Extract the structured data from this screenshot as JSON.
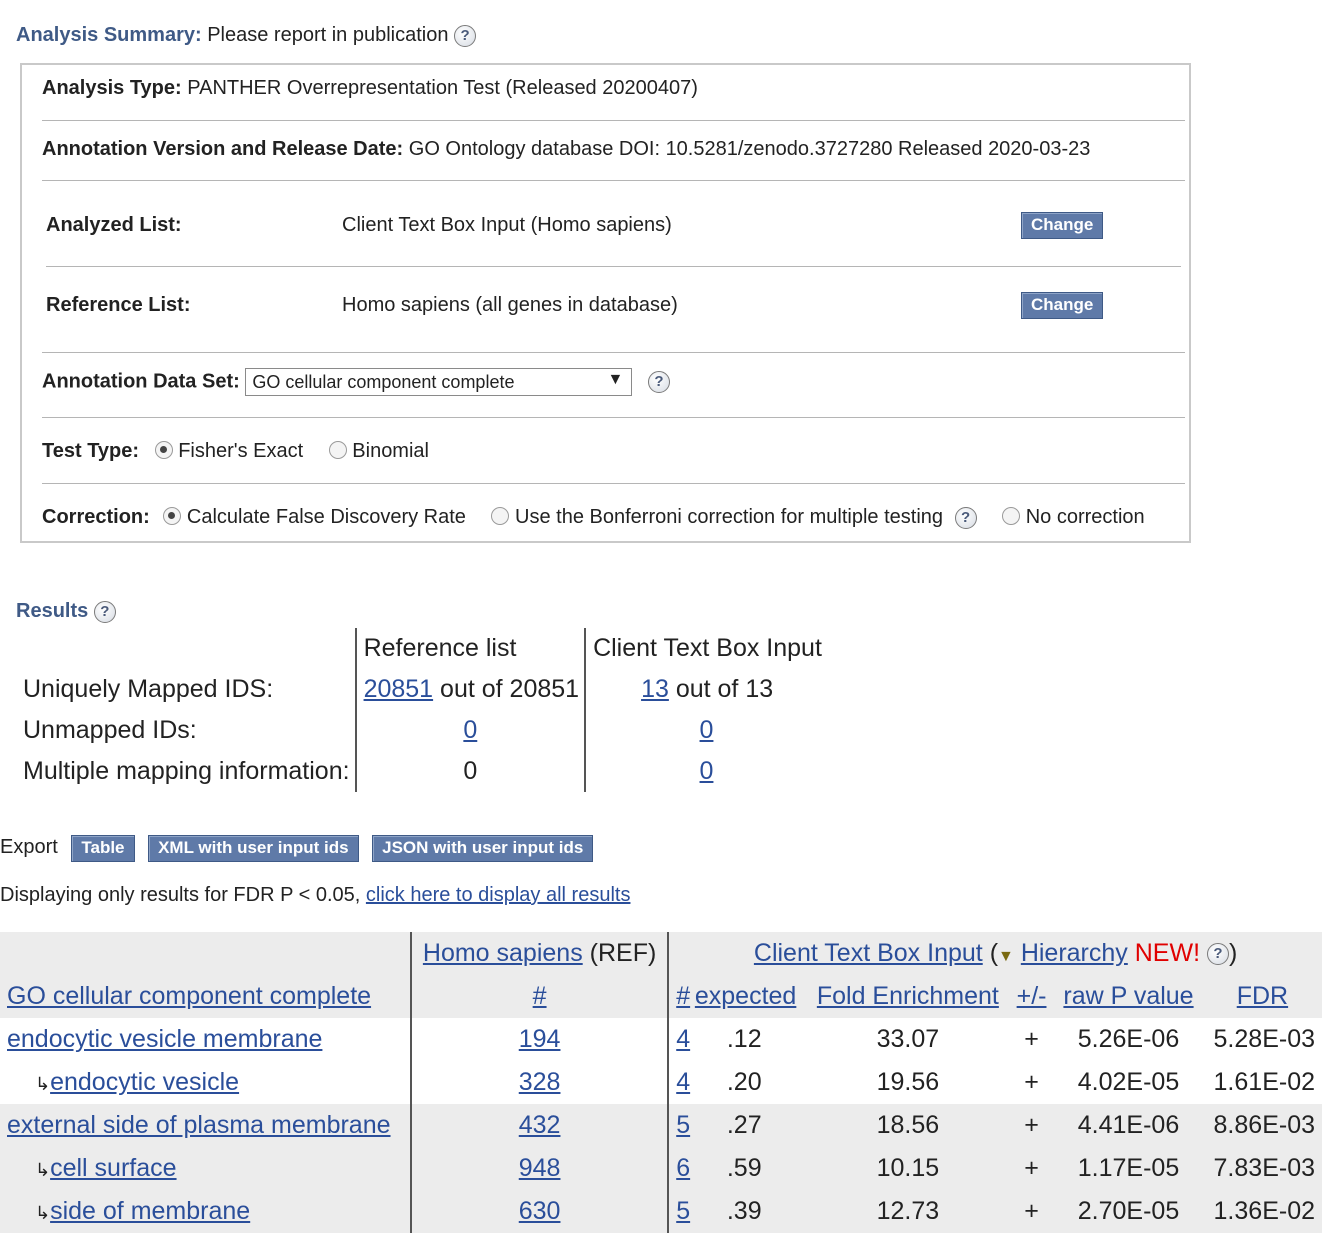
{
  "summary": {
    "heading_bold": "Analysis Summary:",
    "heading_text": "Please report in publication",
    "analysis_type_label": "Analysis Type:",
    "analysis_type_value": "PANTHER Overrepresentation Test (Released 20200407)",
    "annotation_version_label": "Annotation Version and Release Date:",
    "annotation_version_value": "GO Ontology database DOI: 10.5281/zenodo.3727280 Released 2020-03-23",
    "analyzed_list_label": "Analyzed List:",
    "analyzed_list_value": "Client Text Box Input (Homo sapiens)",
    "reference_list_label": "Reference List:",
    "reference_list_value": "Homo sapiens (all genes in database)",
    "change_label": "Change",
    "annotation_dataset_label": "Annotation Data Set:",
    "annotation_dataset_value": "GO cellular component complete",
    "test_type_label": "Test Type:",
    "test_fisher": "Fisher's Exact",
    "test_binomial": "Binomial",
    "correction_label": "Correction:",
    "correction_fdr": "Calculate False Discovery Rate",
    "correction_bonferroni": "Use the Bonferroni correction for multiple testing",
    "correction_none": "No correction"
  },
  "results": {
    "heading": "Results",
    "col_reference": "Reference list",
    "col_client": "Client Text Box Input",
    "uniquely_mapped_label": "Uniquely Mapped IDS:",
    "ref_mapped_count": "20851",
    "ref_mapped_total": "out of 20851",
    "client_mapped_count": "13",
    "client_mapped_total": "out of 13",
    "unmapped_label": "Unmapped IDs:",
    "ref_unmapped": "0",
    "client_unmapped": "0",
    "multiple_label": "Multiple mapping information:",
    "ref_multiple": "0",
    "client_multiple": "0"
  },
  "export": {
    "label": "Export",
    "table_btn": "Table",
    "xml_btn": "XML with user input ids",
    "json_btn": "JSON with user input ids"
  },
  "filter": {
    "text": "Displaying only results for FDR P < 0.05,",
    "link": "click here to display all results"
  },
  "table": {
    "ref_header_link": "Homo sapiens",
    "ref_header_suffix": "(REF)",
    "client_header_link": "Client Text Box Input",
    "hierarchy_link": "Hierarchy",
    "new_label": "NEW!",
    "col_go": "GO cellular component complete",
    "col_ref_count": "#",
    "col_count": "#",
    "col_expected": "expected",
    "col_fold": "Fold Enrichment",
    "col_pm": "+/-",
    "col_raw": "raw P value",
    "col_fdr": "FDR",
    "rows": [
      {
        "term": "endocytic vesicle membrane",
        "indent": false,
        "ref": "194",
        "count": "4",
        "expected": ".12",
        "fold": "33.07",
        "pm": "+",
        "raw": "5.26E-06",
        "fdr": "5.28E-03"
      },
      {
        "term": "endocytic vesicle",
        "indent": true,
        "ref": "328",
        "count": "4",
        "expected": ".20",
        "fold": "19.56",
        "pm": "+",
        "raw": "4.02E-05",
        "fdr": "1.61E-02"
      },
      {
        "term": "external side of plasma membrane",
        "indent": false,
        "ref": "432",
        "count": "5",
        "expected": ".27",
        "fold": "18.56",
        "pm": "+",
        "raw": "4.41E-06",
        "fdr": "8.86E-03"
      },
      {
        "term": "cell surface",
        "indent": true,
        "ref": "948",
        "count": "6",
        "expected": ".59",
        "fold": "10.15",
        "pm": "+",
        "raw": "1.17E-05",
        "fdr": "7.83E-03"
      },
      {
        "term": "side of membrane",
        "indent": true,
        "ref": "630",
        "count": "5",
        "expected": ".39",
        "fold": "12.73",
        "pm": "+",
        "raw": "2.70E-05",
        "fdr": "1.36E-02"
      }
    ]
  }
}
